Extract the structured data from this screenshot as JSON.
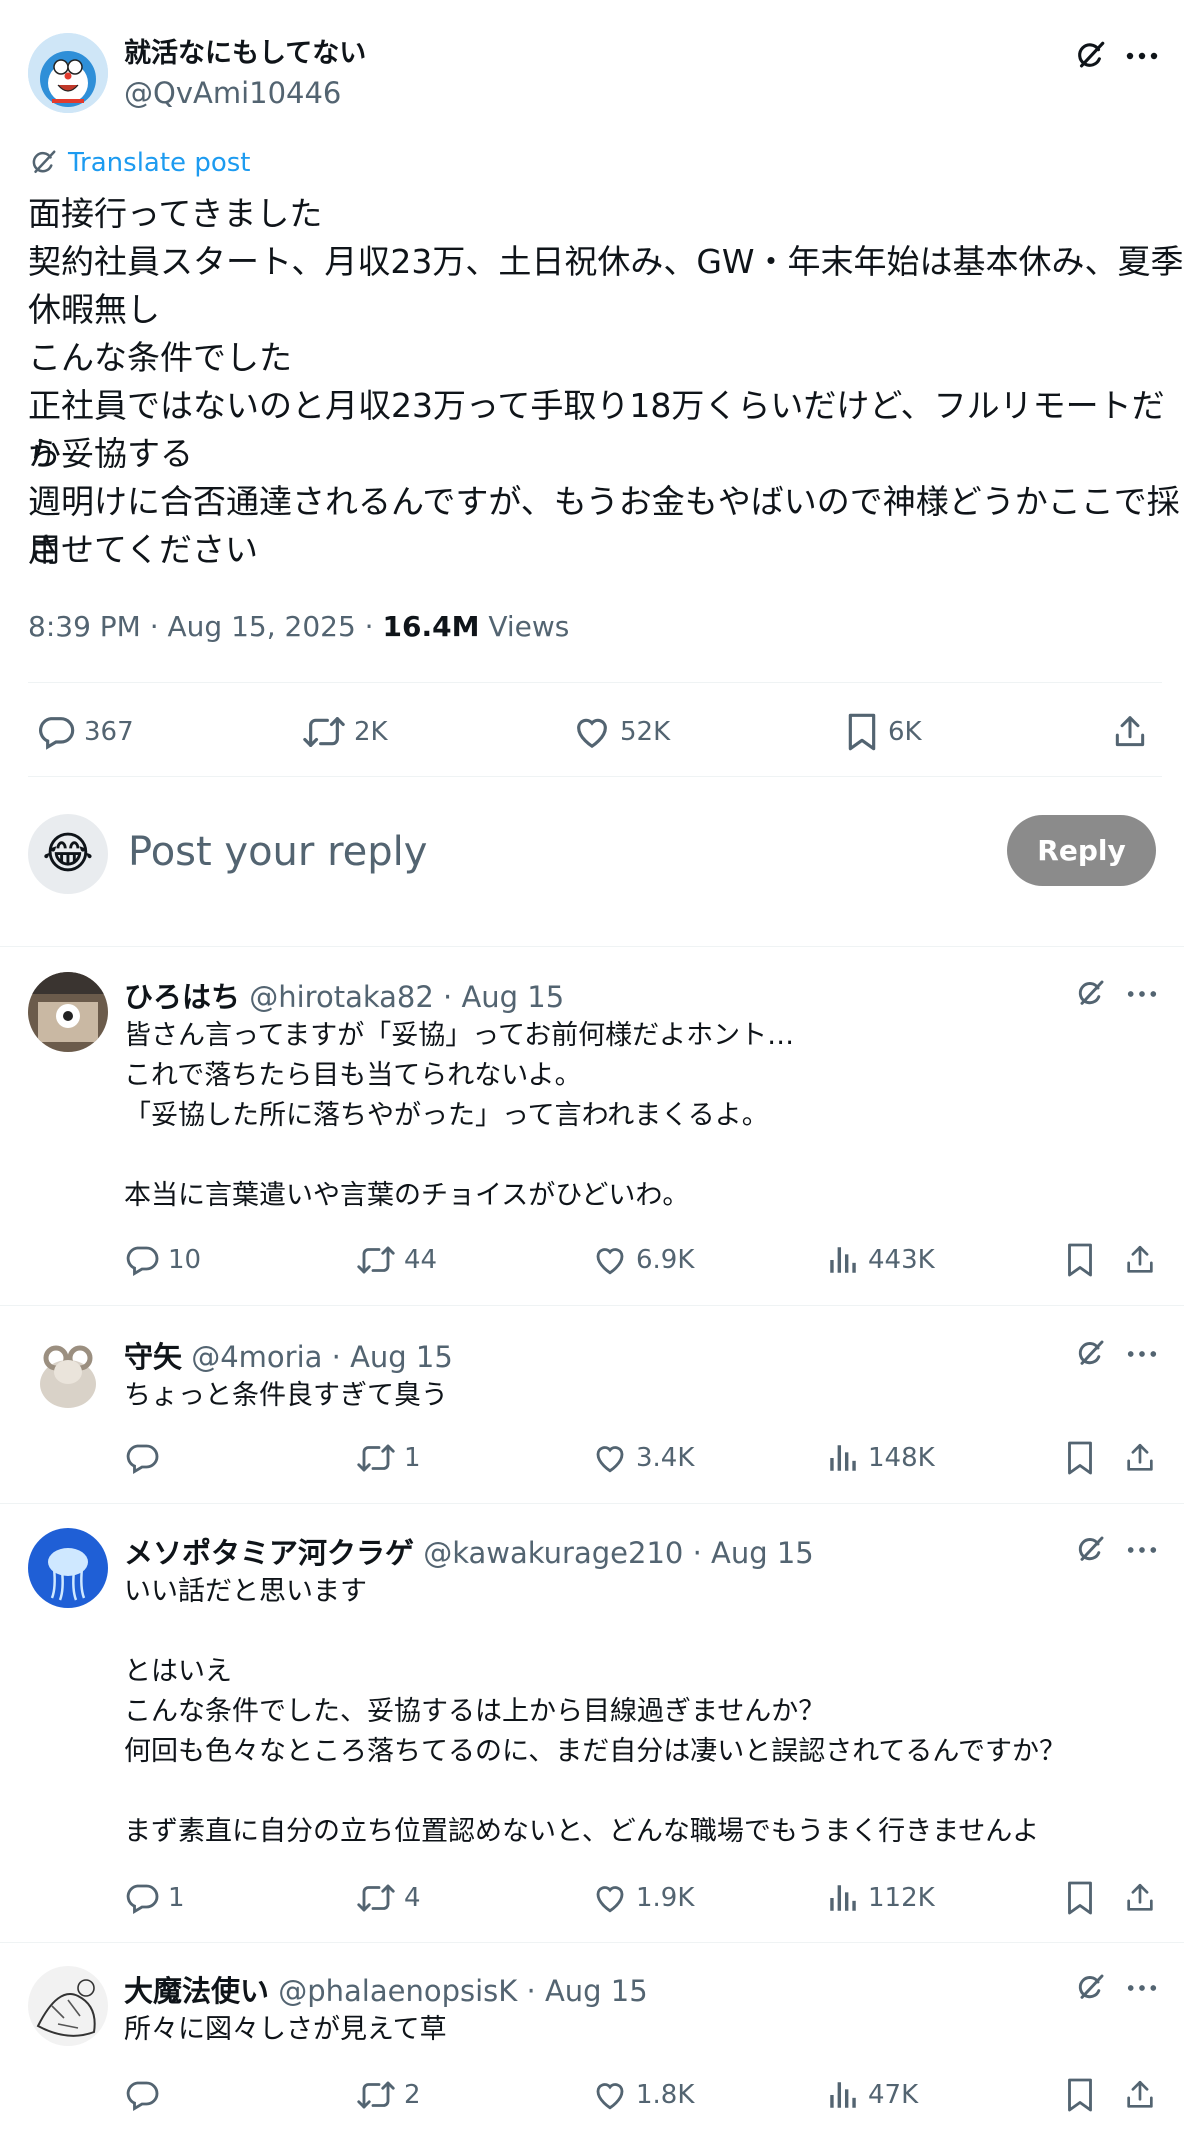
{
  "post": {
    "author_name": "就活なにもしてない",
    "author_handle": "@QvAmi10446",
    "translate_label": "Translate post",
    "lines": [
      "面接行ってきました",
      "契約社員スタート、月収23万、土日祝休み、GW・年末年始は基本休み、夏季",
      "休暇無し",
      "こんな条件でした",
      "正社員ではないのと月収23万って手取り18万くらいだけど、フルリモートだか",
      "ら妥協する",
      "週明けに合否通達されるんですが、もうお金もやばいので神様どうかここで採用",
      "させてください"
    ],
    "time": "8:39 PM · Aug 15, 2025 · ",
    "views_count": "16.4M",
    "views_label": " Views",
    "stats": {
      "replies": "367",
      "reposts": "2K",
      "likes": "52K",
      "bookmarks": "6K"
    }
  },
  "composer": {
    "placeholder": "Post your reply",
    "reply_button": "Reply",
    "avatar_emoji": "😂"
  },
  "replies": [
    {
      "name": "ひろはち",
      "handle": "@hirotaka82",
      "date": " · Aug 15",
      "text": "皆さん言ってますが「妥協」ってお前何様だよホント…\nこれで落ちたら目も当てられないよ。\n「妥協した所に落ちやがった」って言われまくるよ。\n\n本当に言葉遣いや言葉のチョイスがひどいわ。",
      "replies": "10",
      "reposts": "44",
      "likes": "6.9K",
      "views": "443K"
    },
    {
      "name": "守矢",
      "handle": "@4moria",
      "date": " · Aug 15",
      "text": "ちょっと条件良すぎて臭う",
      "replies": "",
      "reposts": "1",
      "likes": "3.4K",
      "views": "148K"
    },
    {
      "name": "メソポタミア河クラゲ",
      "handle": "@kawakurage210",
      "date": " · Aug 15",
      "text": "いい話だと思います\n\nとはいえ\nこんな条件でした、妥協するは上から目線過ぎませんか？\n何回も色々なところ落ちてるのに、まだ自分は凄いと誤認されてるんですか？\n\nまず素直に自分の立ち位置認めないと、どんな職場でもうまく行きませんよ",
      "replies": "1",
      "reposts": "4",
      "likes": "1.9K",
      "views": "112K"
    },
    {
      "name": "大魔法使い",
      "handle": "@phalaenopsisK",
      "date": " · Aug 15",
      "text": "所々に図々しさが見えて草",
      "replies": "",
      "reposts": "2",
      "likes": "1.8K",
      "views": "47K"
    }
  ],
  "colors": {
    "accent": "#1d9bf0",
    "muted": "#536471",
    "reply_button": "#8b8b8b",
    "divider": "#eff3f4"
  },
  "icons": [
    "grok-icon",
    "more-icon",
    "reply-icon",
    "repost-icon",
    "like-icon",
    "bookmark-icon",
    "share-icon",
    "views-icon",
    "translate-icon"
  ]
}
